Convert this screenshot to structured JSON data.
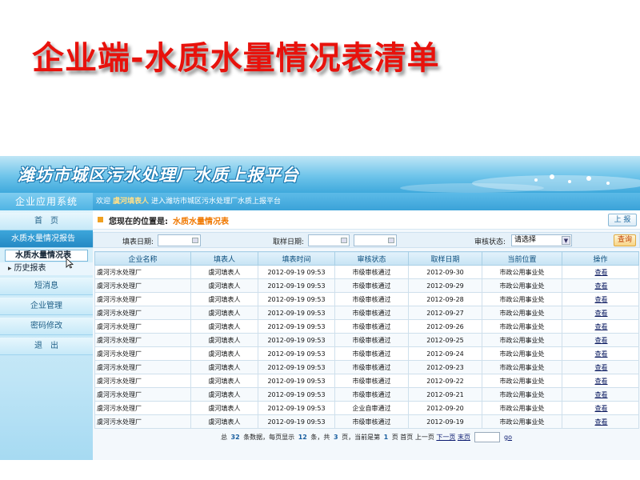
{
  "slide": {
    "title": "企业端-水质水量情况表清单"
  },
  "banner": {
    "title": "潍坊市城区污水处理厂水质上报平台"
  },
  "sidebar": {
    "header": "企业应用系统",
    "home": "首　页",
    "section": "水质水量情况报告",
    "sub_items": [
      "水质水量情况表",
      "历史报表"
    ],
    "items": [
      "短消息",
      "企业管理",
      "密码修改",
      "退　出"
    ]
  },
  "topbar": {
    "welcome": "欢迎",
    "user": "虞河填表人",
    "suffix": "进入潍坊市城区污水处理厂水质上报平台"
  },
  "location": {
    "label": "您现在的位置是:",
    "value": "水质水量情况表",
    "report_button": "上 报"
  },
  "filters": {
    "fill_date_label": "填表日期:",
    "sample_date_label": "取样日期:",
    "status_label": "审核状态:",
    "status_value": "请选择",
    "search_button": "查询"
  },
  "table": {
    "headers": [
      "企业名称",
      "填表人",
      "填表时间",
      "审核状态",
      "取样日期",
      "当前位置",
      "操作"
    ],
    "rows": [
      [
        "虞河污水处理厂",
        "虞河填表人",
        "2012-09-19 09:53",
        "市级审核通过",
        "2012-09-30",
        "市政公用事业处",
        "查看"
      ],
      [
        "虞河污水处理厂",
        "虞河填表人",
        "2012-09-19 09:53",
        "市级审核通过",
        "2012-09-29",
        "市政公用事业处",
        "查看"
      ],
      [
        "虞河污水处理厂",
        "虞河填表人",
        "2012-09-19 09:53",
        "市级审核通过",
        "2012-09-28",
        "市政公用事业处",
        "查看"
      ],
      [
        "虞河污水处理厂",
        "虞河填表人",
        "2012-09-19 09:53",
        "市级审核通过",
        "2012-09-27",
        "市政公用事业处",
        "查看"
      ],
      [
        "虞河污水处理厂",
        "虞河填表人",
        "2012-09-19 09:53",
        "市级审核通过",
        "2012-09-26",
        "市政公用事业处",
        "查看"
      ],
      [
        "虞河污水处理厂",
        "虞河填表人",
        "2012-09-19 09:53",
        "市级审核通过",
        "2012-09-25",
        "市政公用事业处",
        "查看"
      ],
      [
        "虞河污水处理厂",
        "虞河填表人",
        "2012-09-19 09:53",
        "市级审核通过",
        "2012-09-24",
        "市政公用事业处",
        "查看"
      ],
      [
        "虞河污水处理厂",
        "虞河填表人",
        "2012-09-19 09:53",
        "市级审核通过",
        "2012-09-23",
        "市政公用事业处",
        "查看"
      ],
      [
        "虞河污水处理厂",
        "虞河填表人",
        "2012-09-19 09:53",
        "市级审核通过",
        "2012-09-22",
        "市政公用事业处",
        "查看"
      ],
      [
        "虞河污水处理厂",
        "虞河填表人",
        "2012-09-19 09:53",
        "市级审核通过",
        "2012-09-21",
        "市政公用事业处",
        "查看"
      ],
      [
        "虞河污水处理厂",
        "虞河填表人",
        "2012-09-19 09:53",
        "企业自审通过",
        "2012-09-20",
        "市政公用事业处",
        "查看"
      ],
      [
        "虞河污水处理厂",
        "虞河填表人",
        "2012-09-19 09:53",
        "市级审核通过",
        "2012-09-19",
        "市政公用事业处",
        "查看"
      ]
    ]
  },
  "pager": {
    "total_prefix": "总",
    "total_count": "32",
    "total_suffix": "条数据，每页显示",
    "per_page": "12",
    "per_page_suffix": "条，共",
    "pages": "3",
    "pages_suffix": "页，当前是第",
    "current": "1",
    "current_suffix": "页 首页 上一页",
    "next": "下一页",
    "last": "末页",
    "go": "go"
  },
  "colors": {
    "title_red": "#e8120c",
    "accent_blue": "#3aa2d8",
    "highlight_orange": "#f07800"
  }
}
